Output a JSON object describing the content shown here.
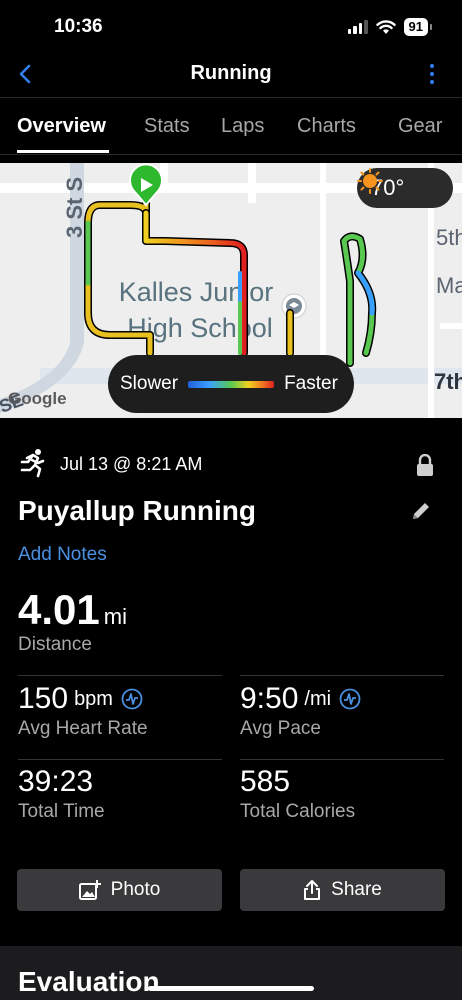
{
  "status_bar": {
    "time": "10:36",
    "battery": "91"
  },
  "nav": {
    "title": "Running"
  },
  "tabs": [
    "Overview",
    "Stats",
    "Laps",
    "Charts",
    "Gear"
  ],
  "map": {
    "weather_temp": "70°",
    "legend_slower": "Slower",
    "legend_faster": "Faster",
    "street_3rd": "3 St S",
    "street_5th": "5th",
    "street_ma": "Ma",
    "street_7th": "7th",
    "street_se": "SE",
    "school_line1": "Kalles Junior",
    "school_line2": "High School",
    "attribution": "Google"
  },
  "activity": {
    "date": "Jul 13 @ 8:21 AM",
    "name": "Puyallup Running",
    "add_notes": "Add Notes"
  },
  "distance": {
    "value": "4.01",
    "unit": "mi",
    "label": "Distance"
  },
  "stats": {
    "heart_rate": {
      "value": "150",
      "unit": "bpm",
      "label": "Avg Heart Rate"
    },
    "pace": {
      "value": "9:50",
      "unit": "/mi",
      "label": "Avg Pace"
    },
    "time": {
      "value": "39:23",
      "label": "Total Time"
    },
    "calories": {
      "value": "585",
      "label": "Total Calories"
    }
  },
  "buttons": {
    "photo": "Photo",
    "share": "Share"
  },
  "evaluation": {
    "title": "Evaluation"
  },
  "colors": {
    "accent": "#2f80ed",
    "link": "#4a90e2",
    "start_marker": "#2db82d"
  }
}
